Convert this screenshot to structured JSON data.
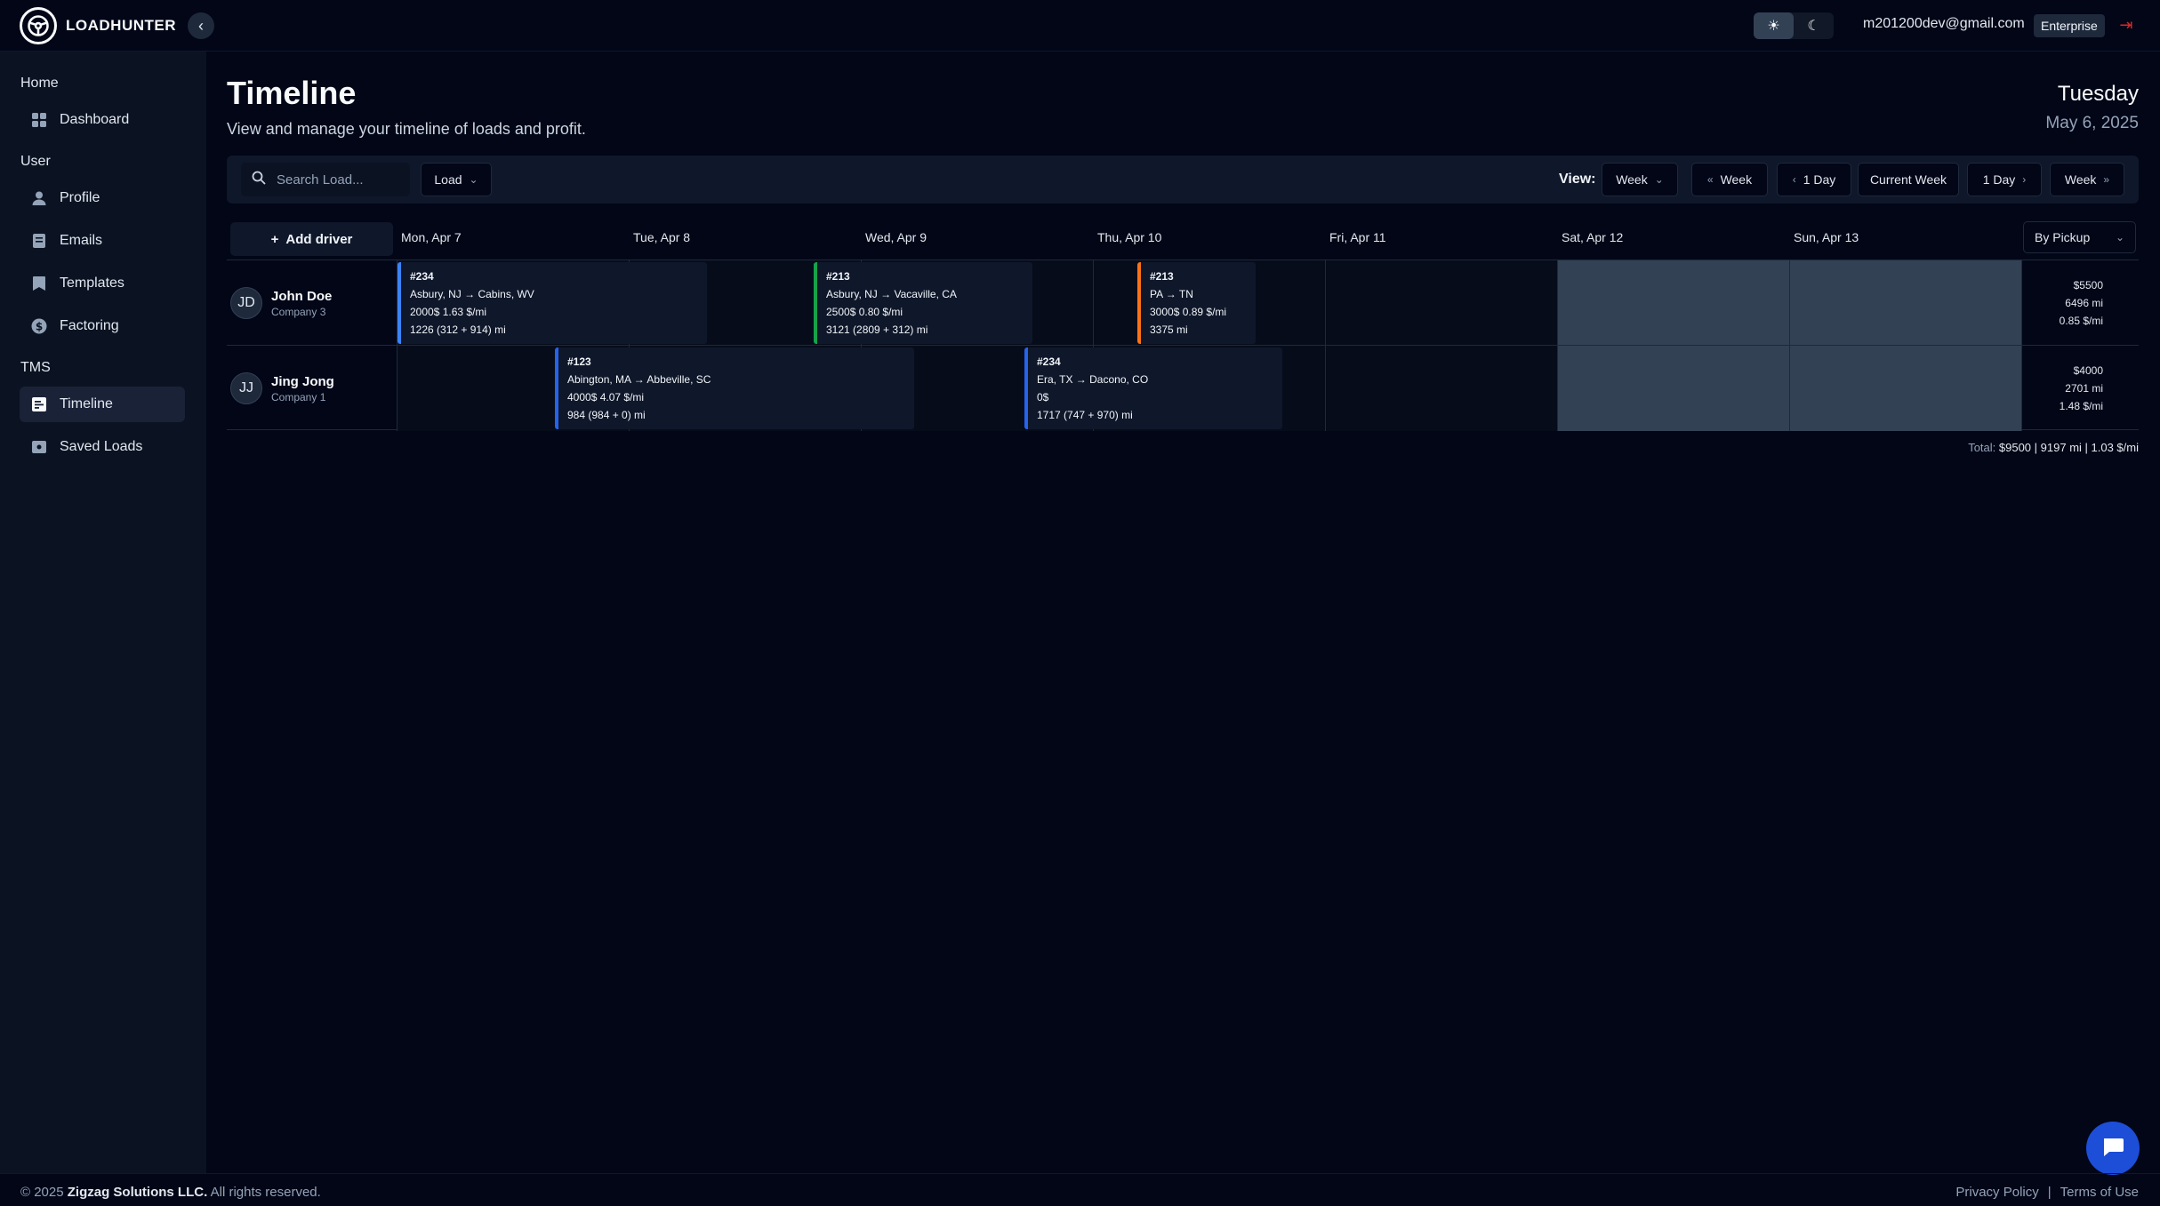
{
  "app": {
    "name": "LOADHUNTER"
  },
  "header": {
    "user_email": "m201200dev@gmail.com",
    "plan": "Enterprise",
    "theme_light_icon": "sun-icon",
    "theme_dark_icon": "moon-icon"
  },
  "sidebar": {
    "sections": [
      {
        "title": "Home",
        "items": [
          {
            "label": "Dashboard",
            "icon": "dashboard-icon"
          }
        ]
      },
      {
        "title": "User",
        "items": [
          {
            "label": "Profile",
            "icon": "user-icon"
          },
          {
            "label": "Emails",
            "icon": "email-icon"
          },
          {
            "label": "Templates",
            "icon": "template-icon"
          },
          {
            "label": "Factoring",
            "icon": "dollar-icon"
          }
        ]
      },
      {
        "title": "TMS",
        "items": [
          {
            "label": "Timeline",
            "icon": "timeline-icon",
            "active": true
          },
          {
            "label": "Saved Loads",
            "icon": "saved-icon"
          }
        ]
      }
    ]
  },
  "page": {
    "title": "Timeline",
    "subtitle": "View and manage your timeline of loads and profit.",
    "day_name": "Tuesday",
    "date": "May 6, 2025"
  },
  "toolbar": {
    "search_placeholder": "Search Load...",
    "filter_value": "Load",
    "view_label": "View:",
    "view_value": "Week",
    "prev_week": "Week",
    "prev_day": "1 Day",
    "current_week": "Current Week",
    "next_day": "1 Day",
    "next_week": "Week"
  },
  "timeline": {
    "add_driver": "Add driver",
    "sort_value": "By Pickup",
    "days": [
      "Mon, Apr 7",
      "Tue, Apr 8",
      "Wed, Apr 9",
      "Thu, Apr 10",
      "Fri, Apr 11",
      "Sat, Apr 12",
      "Sun, Apr 13"
    ],
    "drivers": [
      {
        "initials": "JD",
        "name": "John Doe",
        "company": "Company 3",
        "summary": {
          "revenue": "$5500",
          "miles": "6496 mi",
          "rate": "0.85 $/mi"
        },
        "loads": [
          {
            "num": "#234",
            "route": "Asbury, NJ → Cabins, WV",
            "pay": "2000$ 1.63 $/mi",
            "miles": "1226 (312 + 914) mi",
            "color": "#3b82f6"
          },
          {
            "num": "#213",
            "route": "Asbury, NJ → Vacaville, CA",
            "pay": "2500$ 0.80 $/mi",
            "miles": "3121 (2809 + 312) mi",
            "color": "#16a34a"
          },
          {
            "num": "#213",
            "route": "PA → TN",
            "pay": "3000$ 0.89 $/mi",
            "miles": "3375 mi",
            "color": "#f97316"
          }
        ]
      },
      {
        "initials": "JJ",
        "name": "Jing Jong",
        "company": "Company 1",
        "summary": {
          "revenue": "$4000",
          "miles": "2701 mi",
          "rate": "1.48 $/mi"
        },
        "loads": [
          {
            "num": "#123",
            "route": "Abington, MA → Abbeville, SC",
            "pay": "4000$ 4.07 $/mi",
            "miles": "984 (984 + 0) mi",
            "color": "#2563eb"
          },
          {
            "num": "#234",
            "route": "Era, TX → Dacono, CO",
            "pay": "0$",
            "miles": "1717 (747 + 970) mi",
            "color": "#2563eb"
          }
        ]
      }
    ],
    "total": {
      "label": "Total:",
      "revenue": "$9500",
      "miles": "9197 mi",
      "rate": "1.03 $/mi"
    }
  },
  "footer": {
    "copyright_prefix": "© 2025",
    "company": "Zigzag Solutions LLC.",
    "copyright_suffix": "All rights reserved.",
    "privacy": "Privacy Policy",
    "terms": "Terms of Use"
  }
}
